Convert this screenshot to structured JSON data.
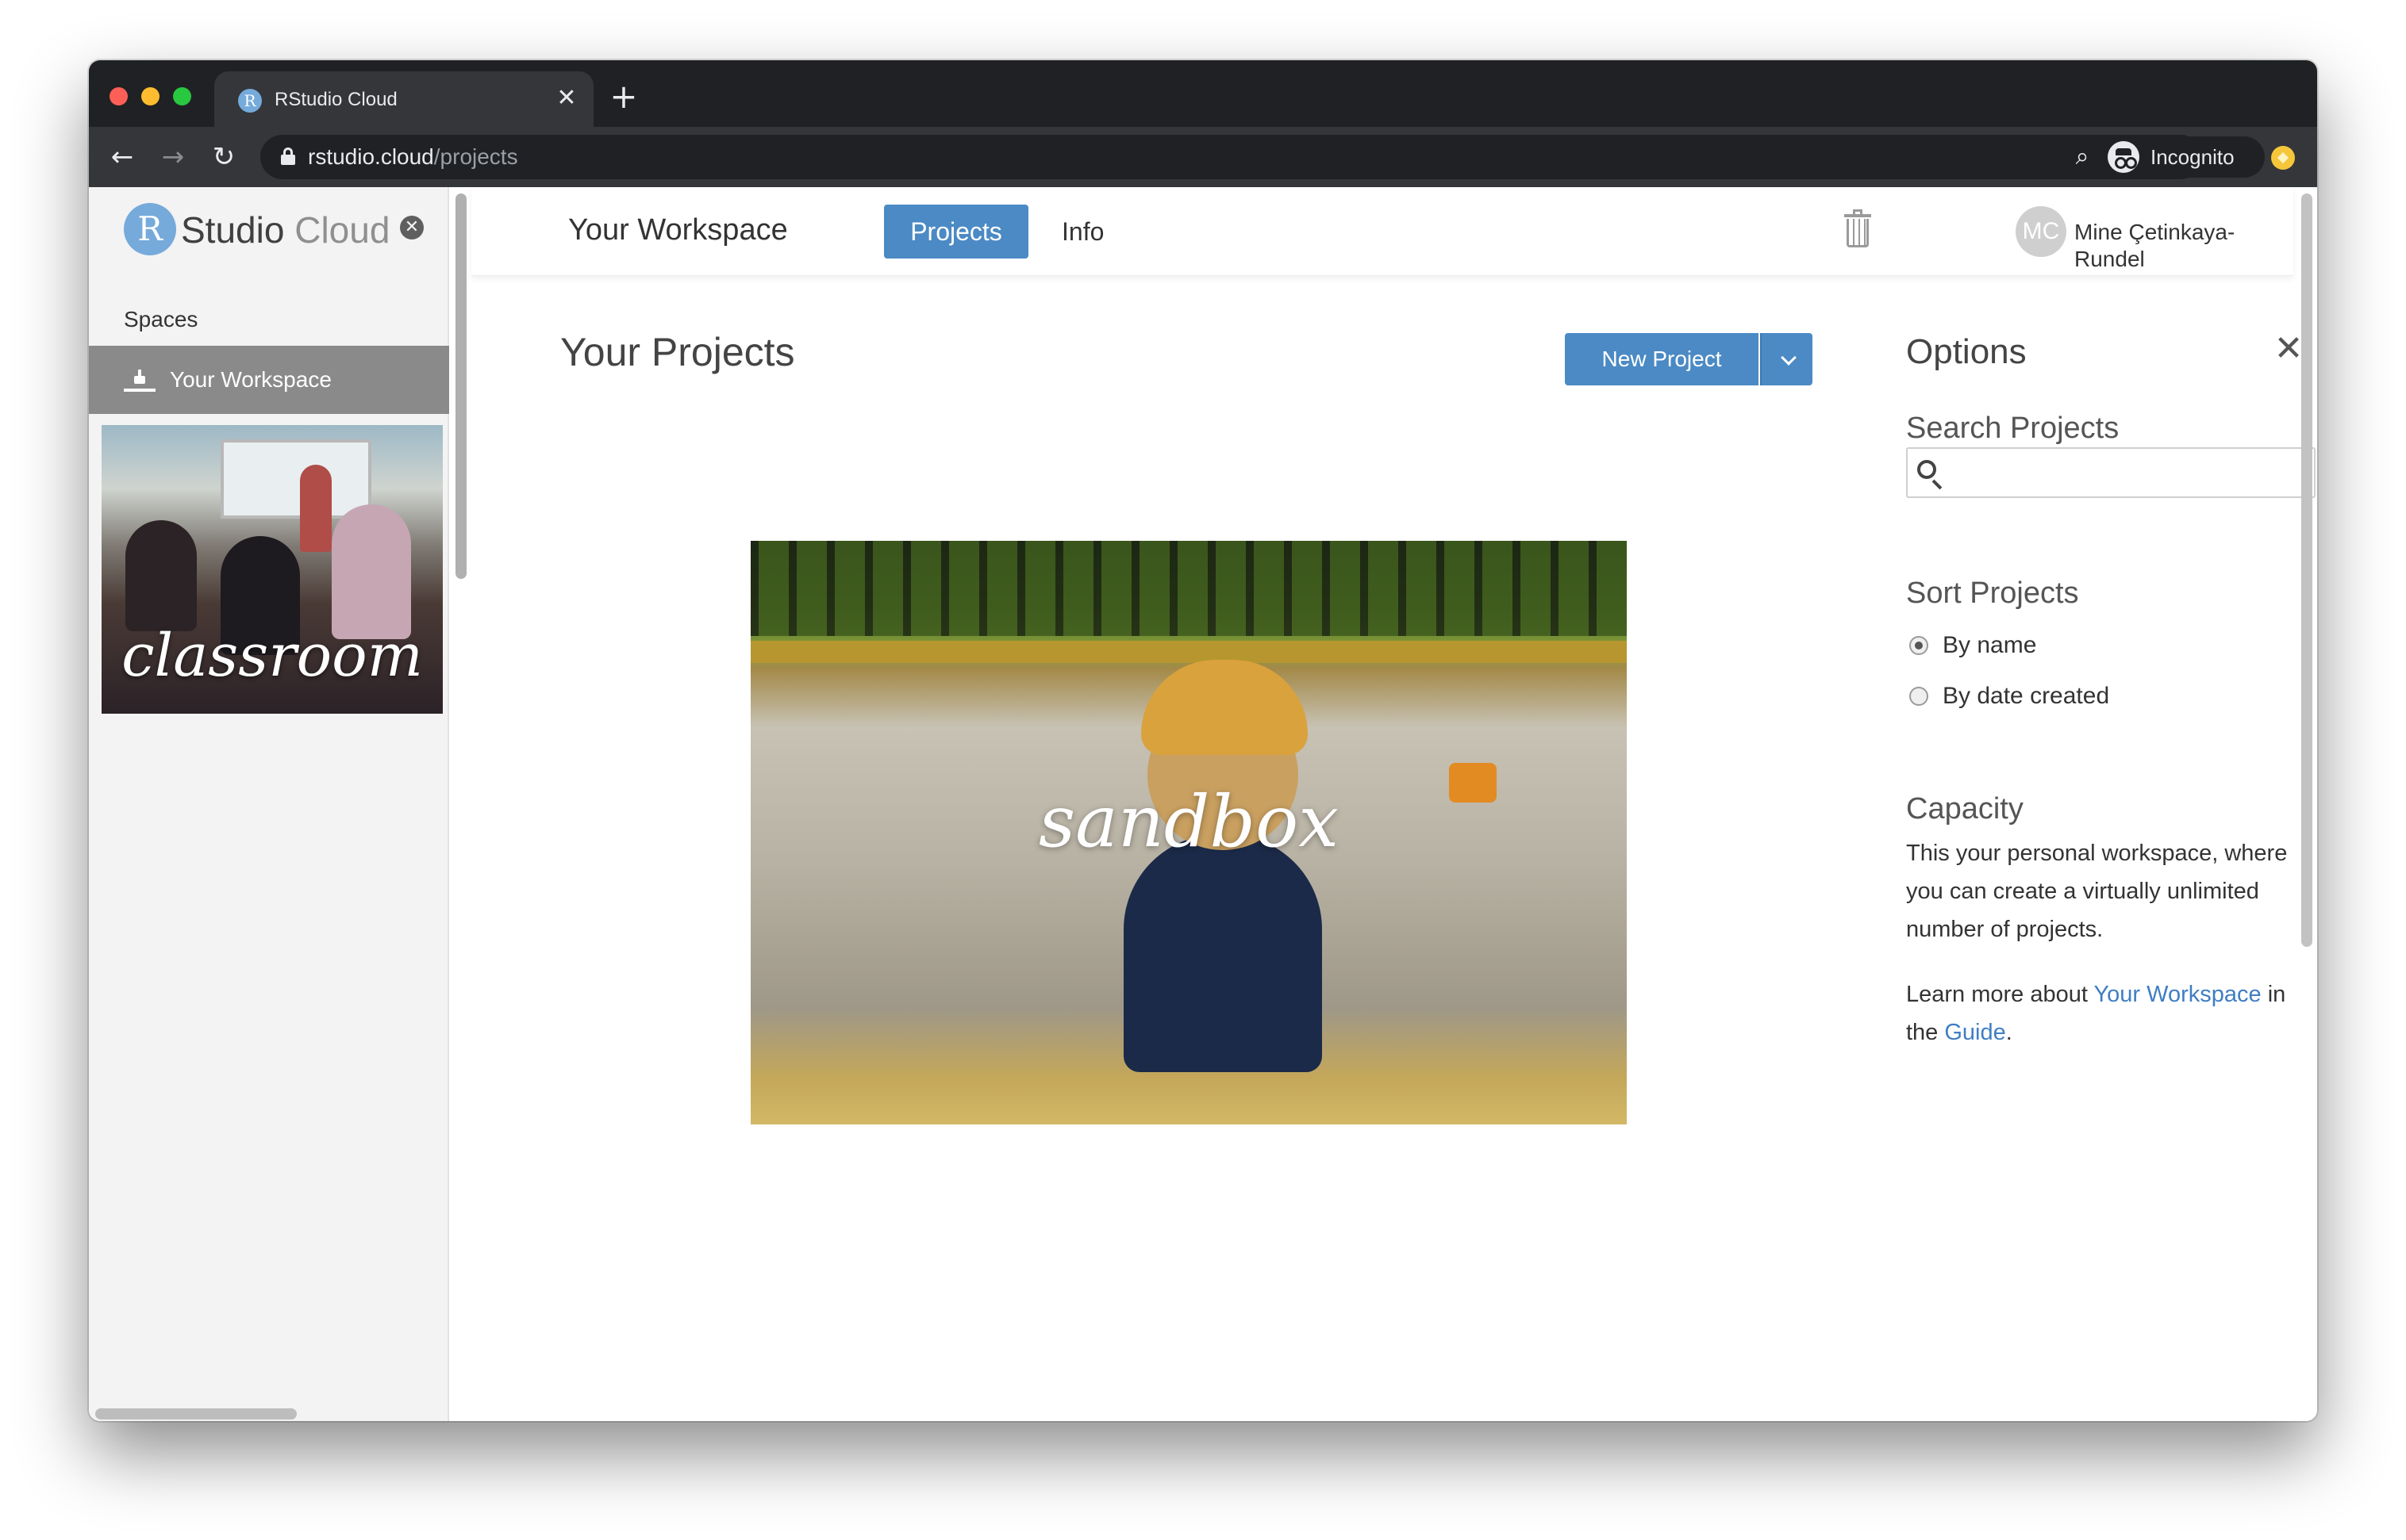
{
  "browser": {
    "tab_title": "RStudio Cloud",
    "tab_favicon_letter": "R",
    "url_host": "rstudio.cloud",
    "url_path": "/projects",
    "profile_label": "Incognito"
  },
  "sidebar": {
    "brand_letter": "R",
    "brand_studio": "Studio",
    "brand_cloud": " Cloud",
    "spaces_label": "Spaces",
    "active_space": "Your Workspace",
    "classroom_label": "classroom"
  },
  "topnav": {
    "workspace_title": "Your Workspace",
    "tabs": [
      {
        "label": "Projects",
        "active": true
      },
      {
        "label": "Info",
        "active": false
      }
    ],
    "avatar_initials": "MC",
    "user_name": "Mine Çetinkaya-Rundel"
  },
  "projects": {
    "heading": "Your Projects",
    "new_project_label": "New Project",
    "sandbox_label": "sandbox"
  },
  "options": {
    "title": "Options",
    "search_label": "Search Projects",
    "search_value": "",
    "sort_label": "Sort Projects",
    "sort_options": [
      {
        "label": "By name",
        "selected": true
      },
      {
        "label": "By date created",
        "selected": false
      }
    ],
    "capacity_label": "Capacity",
    "capacity_text": "This your personal workspace, where you can create a virtually unlimited number of projects.",
    "learn_prefix": "Learn more about ",
    "learn_link": "Your Workspace",
    "learn_mid": " in the ",
    "guide_link": "Guide",
    "learn_suffix": "."
  },
  "colors": {
    "accent": "#4b8ac4",
    "brand_blue": "#75aadb",
    "sidebar_active": "#8a8a8a",
    "link": "#3f7ec4"
  },
  "icons": {
    "tab_close": "close-icon",
    "new_tab": "plus-icon",
    "back": "arrow-left-icon",
    "forward": "arrow-right-icon",
    "reload": "reload-icon",
    "lock": "lock-icon",
    "zoom": "zoom-icon",
    "bookmark": "star-icon",
    "incognito": "incognito-icon",
    "extension": "extension-icon",
    "sidebar_close": "close-circle-icon",
    "workspace": "workspace-icon",
    "trash": "trash-icon",
    "dropdown": "chevron-down-icon",
    "options_close": "close-icon",
    "search": "search-icon"
  }
}
